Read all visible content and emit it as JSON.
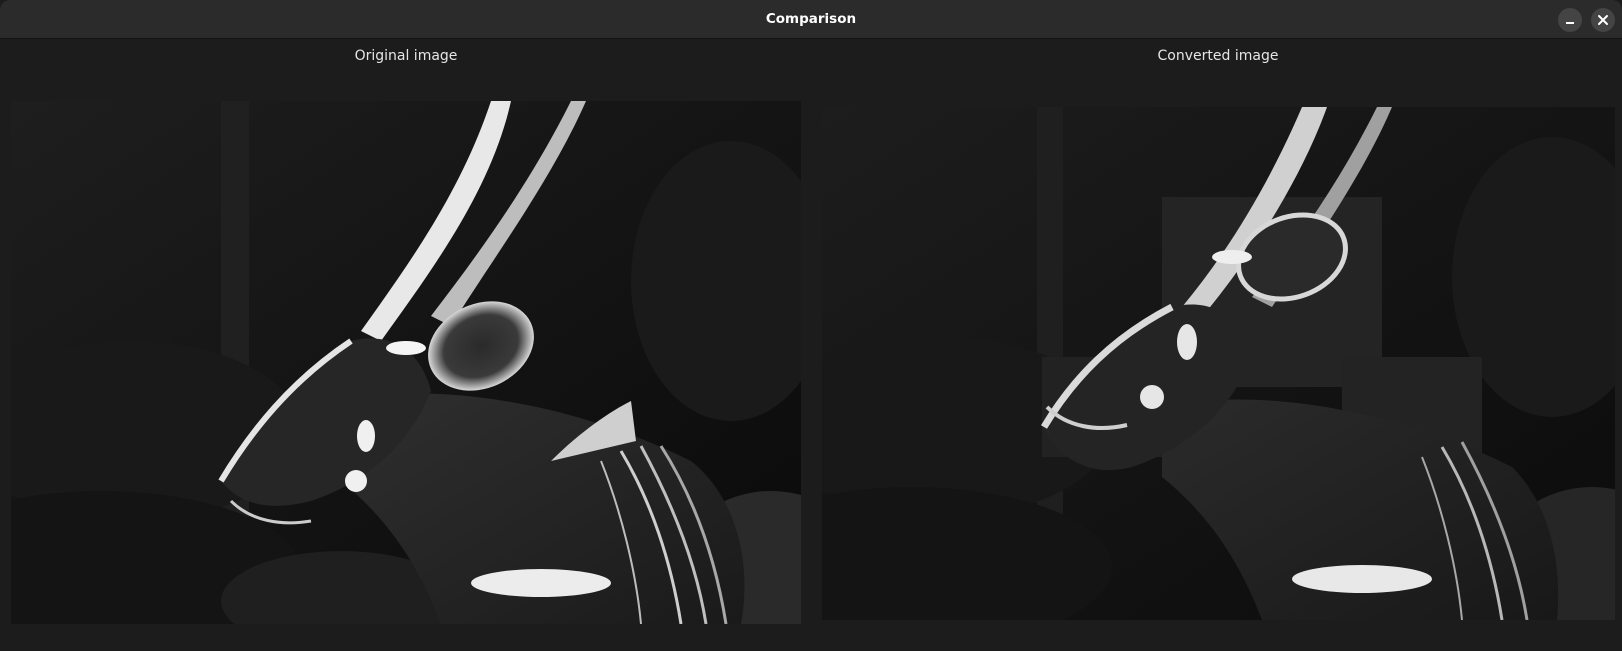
{
  "window": {
    "title": "Comparison"
  },
  "titlebar_buttons": {
    "minimize_icon": "minimize-icon",
    "close_icon": "close-icon"
  },
  "panels": {
    "left_label": "Original image",
    "right_label": "Converted image"
  },
  "images": {
    "left_description_icon": "grayscale-antelope-photo",
    "right_description_icon": "grayscale-antelope-photo-compressed"
  }
}
